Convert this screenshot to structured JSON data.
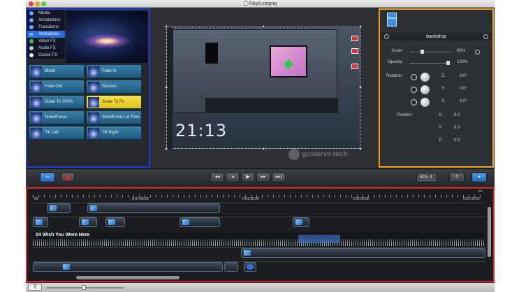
{
  "window": {
    "title": "Floyd.cmproj"
  },
  "media_panel": {
    "menu": [
      {
        "label": "Media",
        "icon": "media-icon"
      },
      {
        "label": "Annotations",
        "icon": "annotations-icon"
      },
      {
        "label": "Transitions",
        "icon": "transitions-icon"
      },
      {
        "label": "Animations",
        "icon": "animations-icon",
        "active": true
      },
      {
        "label": "Video FX",
        "icon": "video-fx-icon"
      },
      {
        "label": "Audio FX",
        "icon": "audio-fx-icon"
      },
      {
        "label": "Cursor FX",
        "icon": "cursor-fx-icon"
      }
    ],
    "tiles": [
      {
        "label": "Blank"
      },
      {
        "label": "Fade In"
      },
      {
        "label": "Fade Out"
      },
      {
        "label": "Restore"
      },
      {
        "label": "Scale To 100%"
      },
      {
        "label": "Scale To Fit",
        "selected": true
      },
      {
        "label": "SmartFocus"
      },
      {
        "label": "SmartFocus at Time"
      },
      {
        "label": "Tilt Left"
      },
      {
        "label": "Tilt Right"
      }
    ]
  },
  "canvas": {
    "clock": "21:13",
    "watermark": "gostarve-tech"
  },
  "properties": {
    "title": "backdrop",
    "scale": {
      "label": "Scale:",
      "value": "95%",
      "level": 0.3
    },
    "opacity": {
      "label": "Opacity:",
      "value": "100%",
      "level": 1.0
    },
    "rotation": {
      "label": "Rotation:",
      "z": {
        "label": "Z:",
        "value": "0.0°"
      },
      "y": {
        "label": "Y:",
        "value": "0.0°"
      },
      "x": {
        "label": "X:",
        "value": "0.0°"
      }
    },
    "position": {
      "label": "Position:",
      "x": {
        "label": "X:",
        "value": "0.0"
      },
      "y": {
        "label": "Y:",
        "value": "0.0"
      },
      "z": {
        "label": "Z:",
        "value": "0.0"
      }
    }
  },
  "toolbar": {
    "zoom": "42%",
    "record_color": "#e5262a",
    "accent": "#2566b8"
  },
  "timeline": {
    "ruler_labels": [
      "00",
      "0:01:00;00",
      "0:01:30;00",
      "0:02:00;00",
      "0:02:30;00"
    ],
    "audio_track_label": "04 Wish You Were Here"
  },
  "colors": {
    "media_panel_border": "#1f3fd6",
    "properties_border": "#f0a020",
    "timeline_border": "#d62a2a",
    "selected_tile": "#f4e24d"
  }
}
